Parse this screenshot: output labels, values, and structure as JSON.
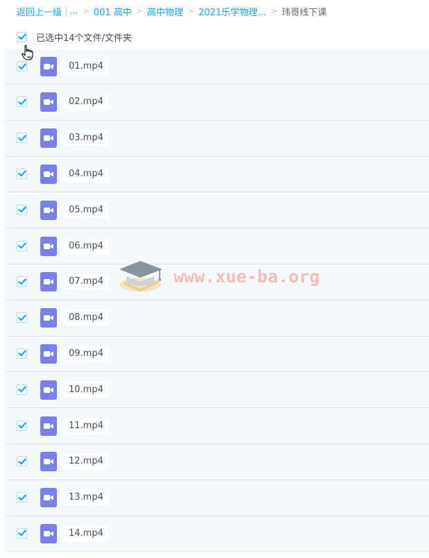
{
  "breadcrumb": {
    "back": "返回上一级",
    "ellipsis": "...",
    "separator": ">",
    "items": [
      "001 高中",
      "高中物理",
      "2021乐学物理..."
    ],
    "current": "玮哥线下课"
  },
  "selection": {
    "text": "已选中14个文件/文件夹",
    "checked": true
  },
  "files": [
    {
      "name": "01.mp4",
      "checked": true
    },
    {
      "name": "02.mp4",
      "checked": true
    },
    {
      "name": "03.mp4",
      "checked": true
    },
    {
      "name": "04.mp4",
      "checked": true
    },
    {
      "name": "05.mp4",
      "checked": true
    },
    {
      "name": "06.mp4",
      "checked": true
    },
    {
      "name": "07.mp4",
      "checked": true
    },
    {
      "name": "08.mp4",
      "checked": true
    },
    {
      "name": "09.mp4",
      "checked": true
    },
    {
      "name": "10.mp4",
      "checked": true
    },
    {
      "name": "11.mp4",
      "checked": true
    },
    {
      "name": "12.mp4",
      "checked": true
    },
    {
      "name": "13.mp4",
      "checked": true
    },
    {
      "name": "14.mp4",
      "checked": true
    }
  ],
  "watermark": "www.xue-ba.org",
  "colors": {
    "link": "#09aaff",
    "check": "#09aaff",
    "video_icon": "#7b7fe9",
    "row_bg": "#f4f9fd"
  },
  "icons": {
    "checkbox": "checkmark-icon",
    "file": "video-file-icon",
    "cursor": "hand-pointer-icon",
    "watermark_logo": "graduation-cap-icon"
  }
}
